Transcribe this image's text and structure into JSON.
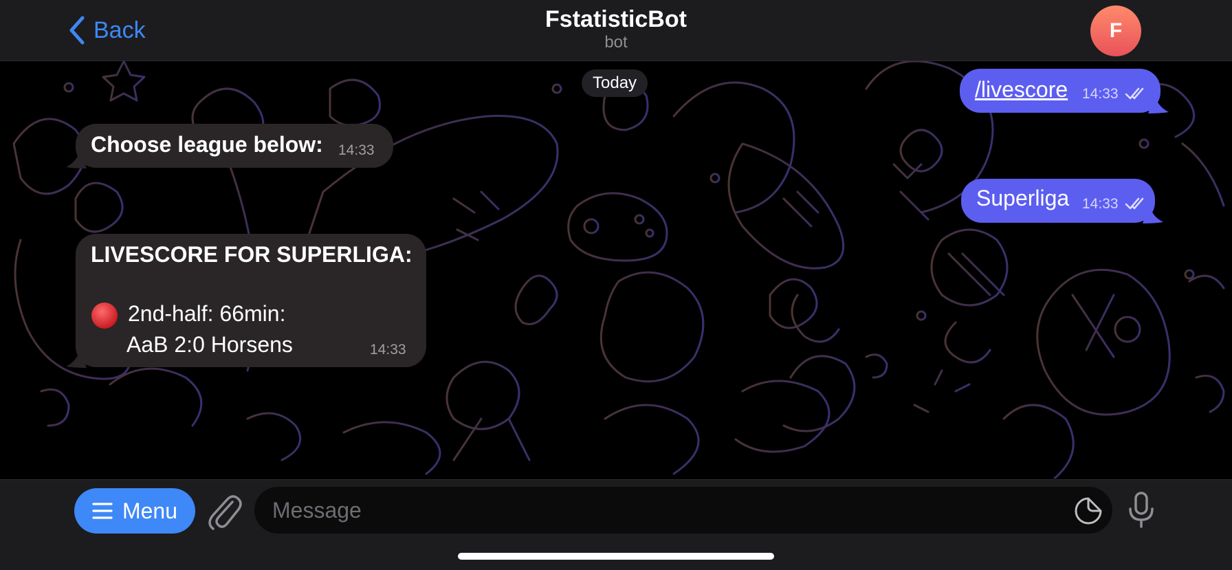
{
  "header": {
    "back_label": "Back",
    "title": "FstatisticBot",
    "subtitle": "bot",
    "avatar_letter": "F"
  },
  "chat": {
    "date_label": "Today",
    "messages": [
      {
        "direction": "outgoing",
        "text": "/livescore",
        "time": "14:33",
        "status": "read"
      },
      {
        "direction": "incoming",
        "text": "Choose league below:",
        "time": "14:33"
      },
      {
        "direction": "outgoing",
        "text": "Superliga",
        "time": "14:33",
        "status": "read"
      },
      {
        "direction": "incoming",
        "heading": "LIVESCORE FOR SUPERLIGA:",
        "line1": "2nd-half: 66min:",
        "line2": "AaB 2:0 Horsens",
        "time": "14:33"
      }
    ]
  },
  "composer": {
    "menu_label": "Menu",
    "placeholder": "Message"
  },
  "colors": {
    "accent": "#3e88f7",
    "outgoing_bubble": "#5c5ef0",
    "incoming_bubble": "#2a2627",
    "avatar": "#ee6a5e",
    "live_dot": "#e0242c"
  },
  "icons": [
    "chevron-left-icon",
    "menu-lines-icon",
    "paperclip-icon",
    "sticker-icon",
    "microphone-icon",
    "double-check-icon",
    "red-circle-icon"
  ]
}
